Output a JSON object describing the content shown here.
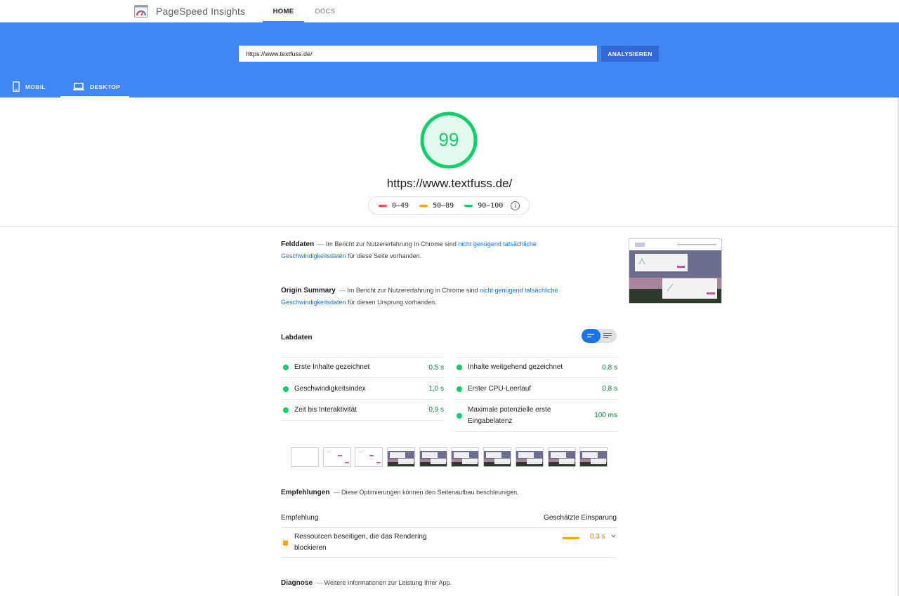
{
  "nav": {
    "brand": "PageSpeed Insights",
    "tabs": [
      {
        "label": "HOME"
      },
      {
        "label": "DOCS"
      }
    ]
  },
  "search": {
    "value": "https://www.textfuss.de/",
    "button_label": "ANALYSIEREN"
  },
  "devices": {
    "mobile_label": "MOBIL",
    "desktop_label": "DESKTOP"
  },
  "score": {
    "value": "99",
    "url": "https://www.textfuss.de/",
    "legend": [
      {
        "label": "0–49",
        "color": "#ff4e42"
      },
      {
        "label": "50–89",
        "color": "#ffa400"
      },
      {
        "label": "90–100",
        "color": "#0cce6b"
      }
    ],
    "info_icon": "i"
  },
  "field_data": {
    "title": "Felddaten",
    "dash": "—",
    "text_before": "Im Bericht zur Nutzererfahrung in Chrome sind",
    "link": "nicht genügend tatsächliche Geschwindigkeitsdaten",
    "text_after": "für diese Seite vorhanden."
  },
  "origin_summary": {
    "title": "Origin Summary",
    "dash": "—",
    "text_before": "Im Bericht zur Nutzererfahrung in Chrome sind",
    "link": "nicht genügend tatsächliche Geschwindigkeitsdaten",
    "text_after": "für diesen Ursprung vorhanden."
  },
  "lab": {
    "title": "Labdaten",
    "metrics": [
      {
        "label": "Erste Inhalte gezeichnet",
        "value": "0,5 s"
      },
      {
        "label": "Inhalte weitgehend gezeichnet",
        "value": "0,8 s"
      },
      {
        "label": "Geschwindigkeitsindex",
        "value": "1,0 s"
      },
      {
        "label": "Erster CPU-Leerlauf",
        "value": "0,8 s"
      },
      {
        "label": "Zeit bis Interaktivität",
        "value": "0,9 s"
      },
      {
        "label": "Maximale potenzielle erste Eingabelatenz",
        "value": "100 ms"
      }
    ]
  },
  "opportunities": {
    "title": "Empfehlungen",
    "dash": "—",
    "subtitle": "Diese Optimierungen können den Seitenaufbau beschleunigen.",
    "col_left": "Empfehlung",
    "col_right": "Geschätzte Einsparung",
    "rows": [
      {
        "label": "Ressourcen beseitigen, die das Rendering blockieren",
        "value": "0,3 s"
      }
    ]
  },
  "diagnostics": {
    "title": "Diagnose",
    "dash": "—",
    "subtitle": "Weitere Informationen zur Leistung Ihrer App."
  }
}
